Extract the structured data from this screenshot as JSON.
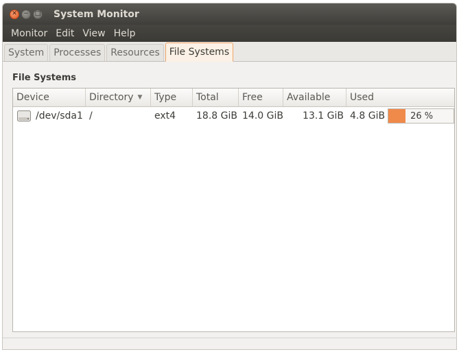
{
  "window": {
    "title": "System Monitor"
  },
  "titlebar_buttons": {
    "close_glyph": "✕",
    "minimize_glyph": "−",
    "maximize_glyph": "□"
  },
  "menu": [
    "Monitor",
    "Edit",
    "View",
    "Help"
  ],
  "tabs": [
    "System",
    "Processes",
    "Resources",
    "File Systems"
  ],
  "active_tab": "File Systems",
  "section_title": "File Systems",
  "table": {
    "headers": {
      "device": "Device",
      "directory": "Directory",
      "directory_sort_glyph": "▼",
      "type": "Type",
      "total": "Total",
      "free": "Free",
      "available": "Available",
      "used": "Used"
    },
    "rows": [
      {
        "device": "/dev/sda1",
        "device_icon": "harddisk-icon",
        "directory": "/",
        "type": "ext4",
        "total": "18.8 GiB",
        "free": "14.0 GiB",
        "available": "13.1 GiB",
        "used": "4.8 GiB",
        "used_percent_label": "26 %",
        "used_fraction": 0.26
      }
    ]
  },
  "colors": {
    "accent_orange": "#f08a4b",
    "titlebar_dark": "#3c3b37",
    "close_button": "#e0571c"
  }
}
